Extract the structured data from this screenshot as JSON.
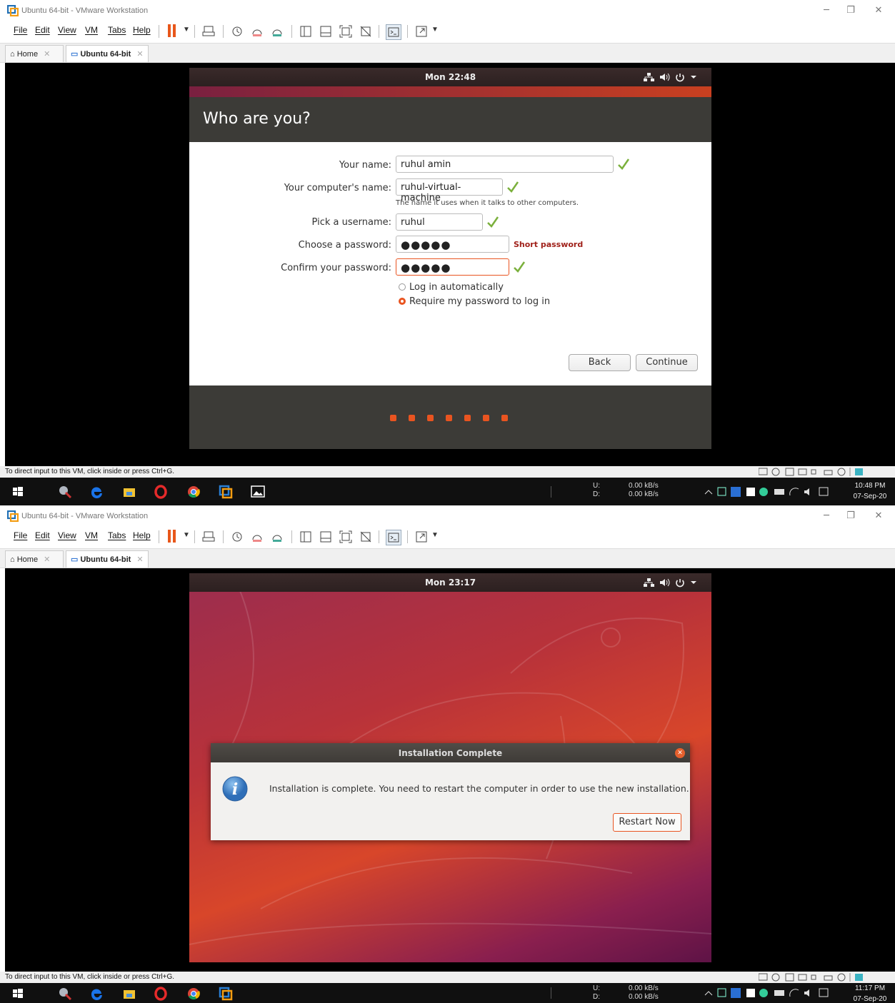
{
  "screens": [
    {
      "window_title": "Ubuntu 64-bit - VMware Workstation",
      "menu": [
        "File",
        "Edit",
        "View",
        "VM",
        "Tabs",
        "Help"
      ],
      "tabs": [
        {
          "label": "Home"
        },
        {
          "label": "Ubuntu 64-bit"
        }
      ],
      "guest_clock": "Mon 22:48",
      "status_text": "To direct input to this VM, click inside or press Ctrl+G.",
      "net": {
        "up_label": "U:",
        "down_label": "D:",
        "up": "0.00 kB/s",
        "down": "0.00 kB/s"
      },
      "clock": {
        "time": "10:48 PM",
        "date": "07-Sep-20"
      }
    },
    {
      "window_title": "Ubuntu 64-bit - VMware Workstation",
      "menu": [
        "File",
        "Edit",
        "View",
        "VM",
        "Tabs",
        "Help"
      ],
      "tabs": [
        {
          "label": "Home"
        },
        {
          "label": "Ubuntu 64-bit"
        }
      ],
      "guest_clock": "Mon 23:17",
      "status_text": "To direct input to this VM, click inside or press Ctrl+G.",
      "net": {
        "up_label": "U:",
        "down_label": "D:",
        "up": "0.00 kB/s",
        "down": "0.00 kB/s"
      },
      "clock": {
        "time": "11:17 PM",
        "date": "07-Sep-20"
      }
    }
  ],
  "installer": {
    "heading": "Who are you?",
    "name_label": "Your name:",
    "name_value": "ruhul amin",
    "computer_label": "Your computer's name:",
    "computer_value": "ruhul-virtual-machine",
    "computer_hint": "The name it uses when it talks to other computers.",
    "username_label": "Pick a username:",
    "username_value": "ruhul",
    "password_label": "Choose a password:",
    "password_value": "●●●●●",
    "password_strength": "Short password",
    "confirm_label": "Confirm your password:",
    "confirm_value": "●●●●●",
    "login_auto": "Log in automatically",
    "login_password": "Require my password to log in",
    "login_selected": "Require my password to log in",
    "back": "Back",
    "continue": "Continue",
    "progress_steps": 7
  },
  "dialog": {
    "title": "Installation Complete",
    "message": "Installation is complete. You need to restart the computer in order to use the new installation.",
    "button": "Restart Now",
    "icon": "info-icon"
  },
  "colors": {
    "ubuntu_orange": "#e95420",
    "aubergine": "#3c3b37",
    "vmware_pause": "#e8571b"
  }
}
